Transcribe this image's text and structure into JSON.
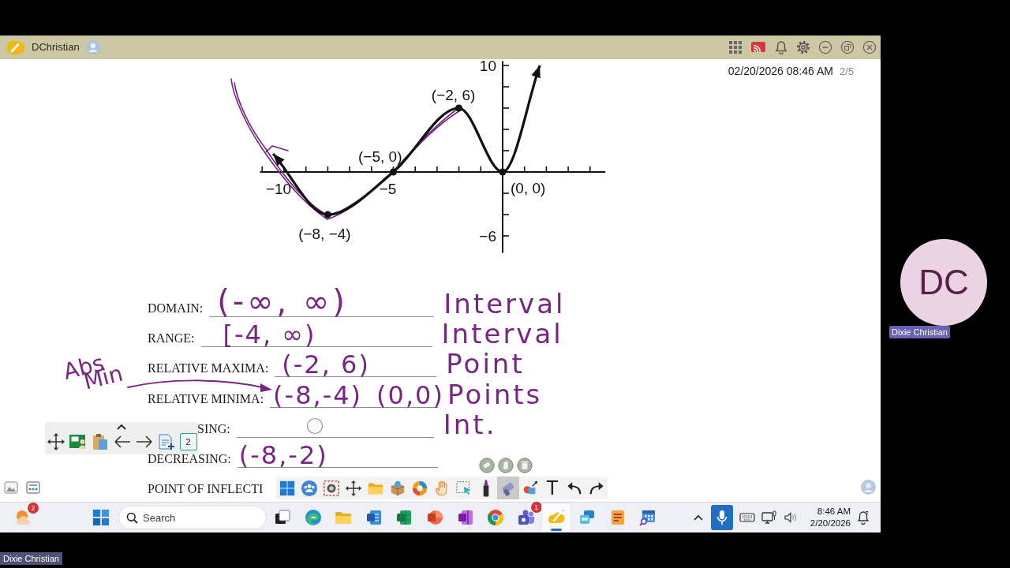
{
  "top_bar": {
    "user_name": "DChristian"
  },
  "canvas": {
    "timestamp": "02/20/2026 08:46 AM",
    "page_counter": "2/5",
    "graph": {
      "chart_data": {
        "type": "line",
        "x": [
          -10.5,
          -8,
          -5,
          -2,
          0,
          1.7
        ],
        "series": [
          {
            "color": "#111111",
            "values": [
              1.7,
              -4,
              0,
              6,
              0,
              10
            ]
          }
        ],
        "xlim": [
          -11.1,
          4.7
        ],
        "ylim": [
          -7.6,
          10.4
        ],
        "xticks": [
          {
            "value": -10,
            "label": "−10"
          },
          {
            "value": -5,
            "label": "−5"
          }
        ],
        "yticks": [
          {
            "value": 10,
            "label": "10"
          },
          {
            "value": -6,
            "label": "−6"
          }
        ],
        "annotations": [
          {
            "x": -2,
            "y": 6,
            "text": "(−2, 6)"
          },
          {
            "x": -5,
            "y": 0,
            "text": "(−5, 0)"
          },
          {
            "x": 0,
            "y": 0,
            "text": "(0, 0)"
          },
          {
            "x": -8,
            "y": -4,
            "text": "(−8, −4)"
          }
        ]
      }
    },
    "worksheet": [
      {
        "kind": "answer_line",
        "label": "DOMAIN:",
        "answers": [
          "(-∞, ∞)"
        ],
        "note": "Interval"
      },
      {
        "kind": "answer_line",
        "label": "RANGE:",
        "answers": [
          "[-4, ∞)"
        ],
        "note": "Interval"
      },
      {
        "kind": "answer_line",
        "label": "RELATIVE MAXIMA:",
        "answers": [
          "(-2, 6)"
        ],
        "note": "Point"
      },
      {
        "kind": "answer_line",
        "label": "RELATIVE MINIMA:",
        "answers": [
          "(-8,-4)",
          "(0,0)"
        ],
        "note": "Points"
      },
      {
        "kind": "answer_line",
        "label": "SING:",
        "note": "Int."
      },
      {
        "kind": "answer_line",
        "label": "DECREASING:",
        "answers": [
          "(-8,-2)"
        ]
      },
      {
        "kind": "label_only",
        "label": "POINT OF INFLECTI"
      }
    ],
    "ink_note": {
      "lines": [
        "Abs",
        "Min"
      ]
    }
  },
  "page_tools": {
    "page_number": "2"
  },
  "whiteboard_toolbar": {
    "tools": [
      {
        "kind": "start",
        "selected": false
      },
      {
        "kind": "people",
        "selected": false
      },
      {
        "kind": "capture",
        "selected": false
      },
      {
        "kind": "move",
        "selected": false
      },
      {
        "kind": "folder",
        "selected": false
      },
      {
        "kind": "box",
        "selected": false
      },
      {
        "kind": "ball",
        "selected": false
      },
      {
        "kind": "hand",
        "selected": false
      },
      {
        "kind": "select",
        "selected": false
      },
      {
        "kind": "marker",
        "selected": false
      },
      {
        "kind": "eraser",
        "selected": true
      },
      {
        "kind": "shapes",
        "selected": false
      },
      {
        "kind": "text",
        "label": "T",
        "selected": false
      },
      {
        "kind": "undo",
        "selected": false
      },
      {
        "kind": "redo",
        "selected": false
      }
    ]
  },
  "taskbar": {
    "widgets_badge": "2",
    "search": {
      "placeholder": "Search"
    },
    "apps": [
      {
        "kind": "task-view",
        "selected": false
      },
      {
        "kind": "edge",
        "selected": false
      },
      {
        "kind": "files",
        "selected": false
      },
      {
        "kind": "word",
        "selected": false
      },
      {
        "kind": "excel",
        "selected": false
      },
      {
        "kind": "powerpoint",
        "selected": false
      },
      {
        "kind": "onenote",
        "selected": false
      },
      {
        "kind": "chrome",
        "selected": false
      },
      {
        "kind": "teams",
        "badge": "1",
        "selected": false
      },
      {
        "kind": "whiteboard",
        "selected": true
      },
      {
        "kind": "phone",
        "selected": false
      },
      {
        "kind": "reader",
        "selected": false
      },
      {
        "kind": "calendar",
        "selected": false
      }
    ],
    "microphone": {
      "on": true
    },
    "clock": {
      "time": "8:46 AM",
      "date": "2/20/2026"
    }
  },
  "participant": {
    "initials": "DC",
    "name": "Dixie Christian"
  },
  "self_view": {
    "name": "Dixie Christian"
  }
}
